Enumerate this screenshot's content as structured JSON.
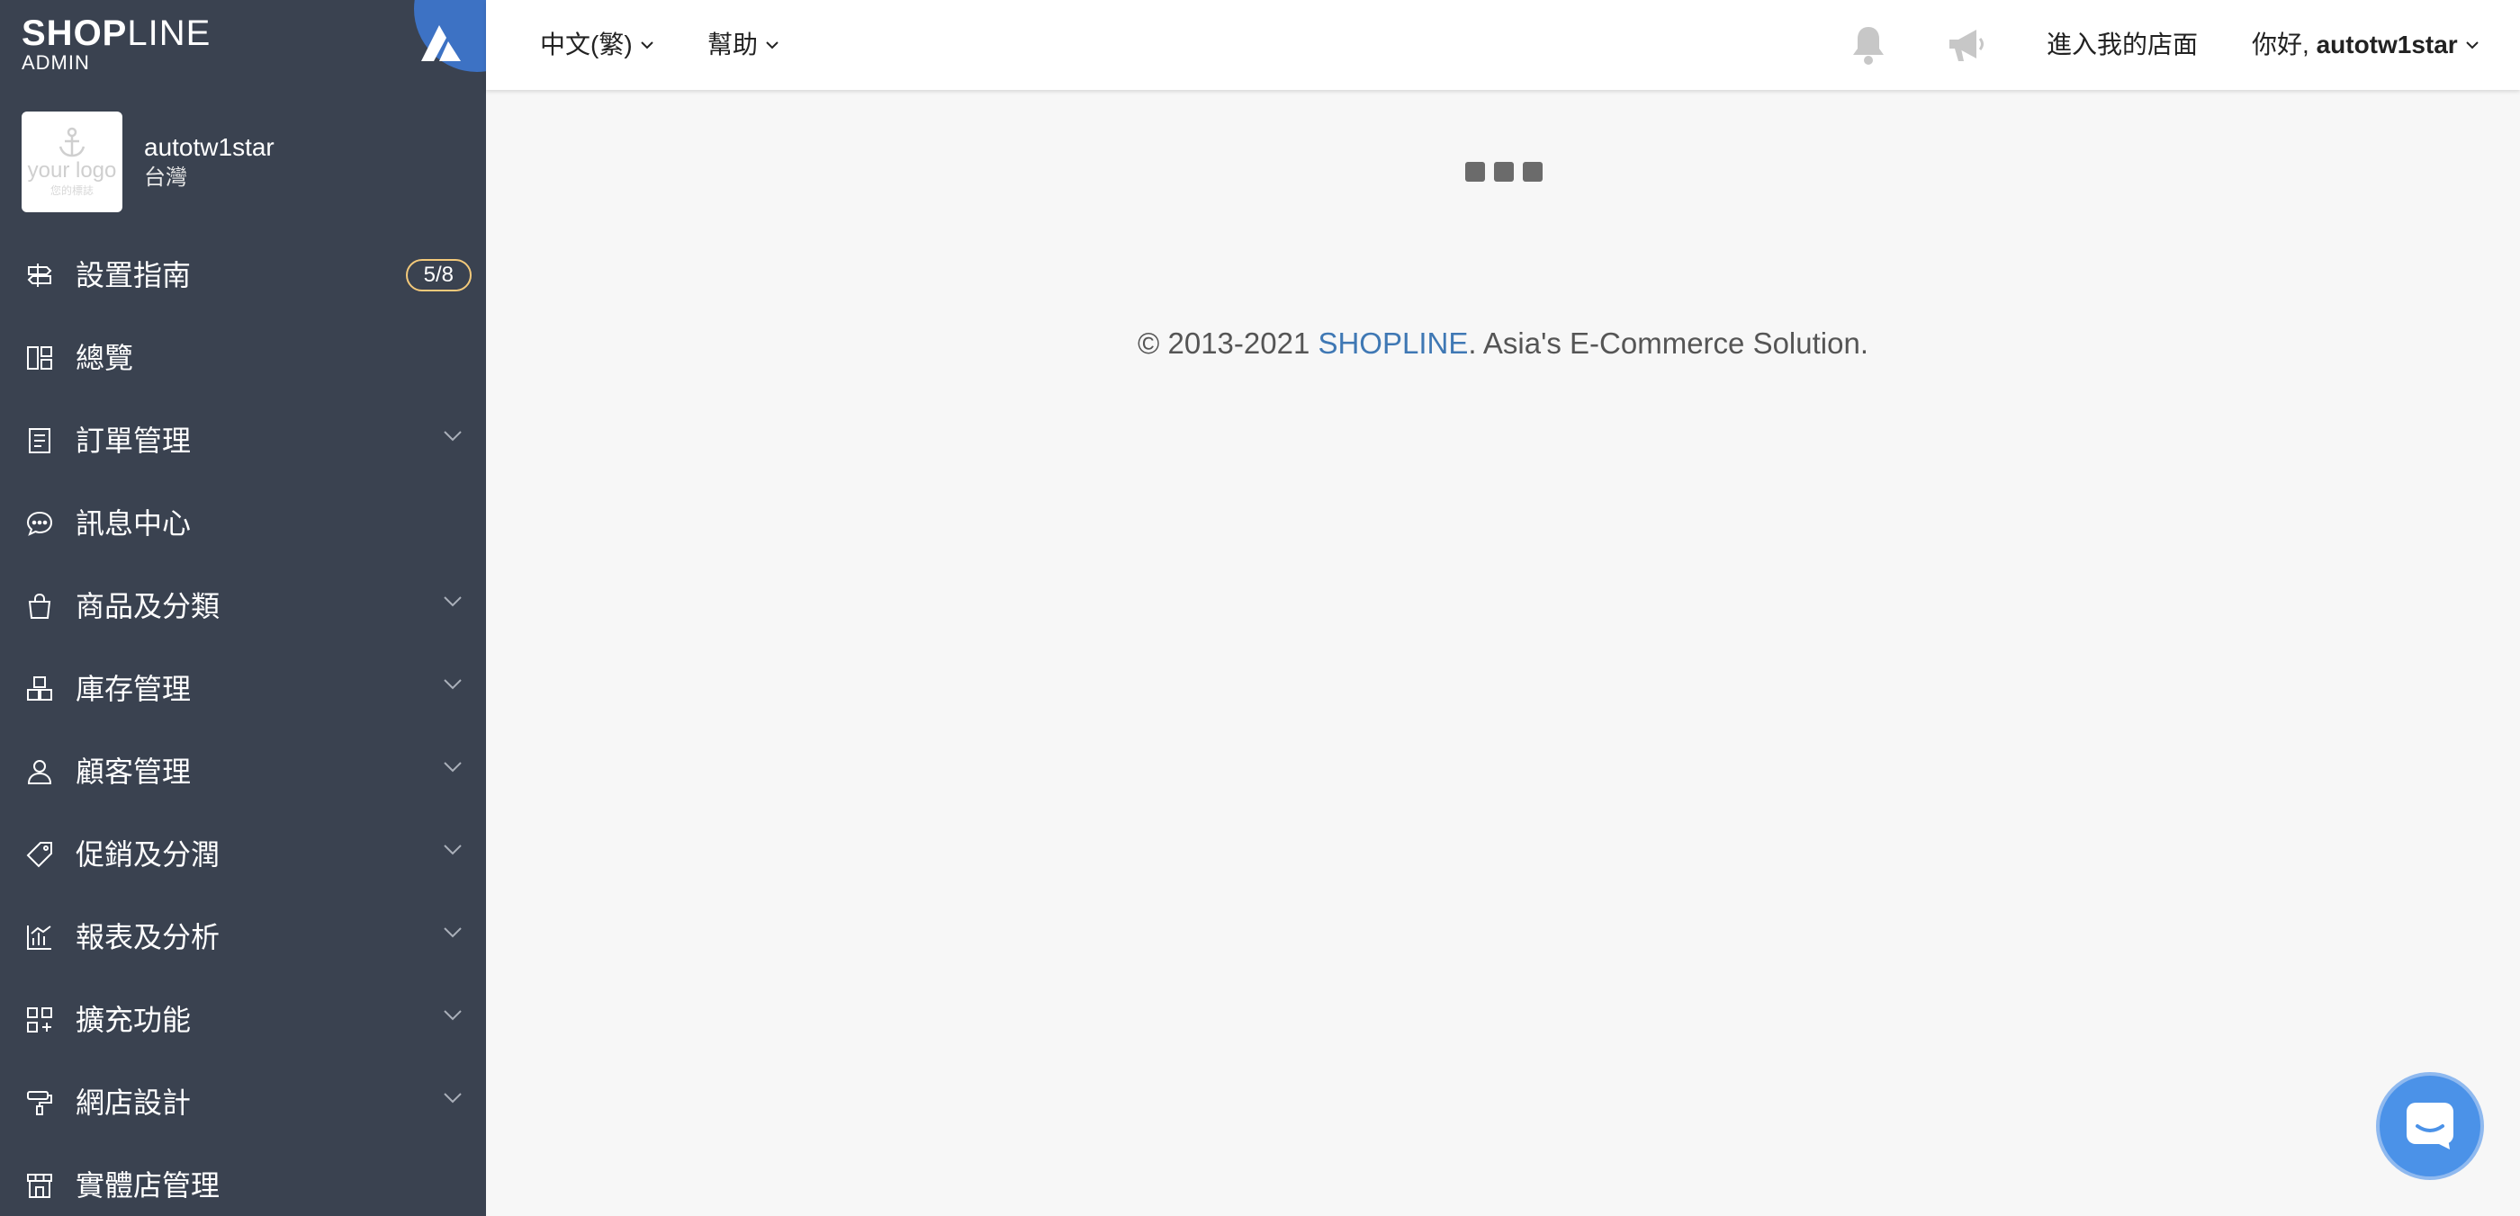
{
  "brand": {
    "name": "SHOPLINE",
    "sub": "ADMIN"
  },
  "store": {
    "name": "autotw1star",
    "region": "台灣",
    "logo_text": "your logo",
    "logo_caption": "您的標誌"
  },
  "sidebar": {
    "items": [
      {
        "label": "設置指南",
        "icon": "signpost-icon",
        "badge": "5/8",
        "has_chevron": false
      },
      {
        "label": "總覽",
        "icon": "dashboard-icon",
        "has_chevron": false
      },
      {
        "label": "訂單管理",
        "icon": "order-icon",
        "has_chevron": true
      },
      {
        "label": "訊息中心",
        "icon": "chat-bubble-icon",
        "has_chevron": false
      },
      {
        "label": "商品及分類",
        "icon": "shopping-bag-icon",
        "has_chevron": true
      },
      {
        "label": "庫存管理",
        "icon": "inventory-icon",
        "has_chevron": true
      },
      {
        "label": "顧客管理",
        "icon": "user-icon",
        "has_chevron": true
      },
      {
        "label": "促銷及分潤",
        "icon": "tag-icon",
        "has_chevron": true
      },
      {
        "label": "報表及分析",
        "icon": "chart-icon",
        "has_chevron": true
      },
      {
        "label": "擴充功能",
        "icon": "apps-icon",
        "has_chevron": true
      },
      {
        "label": "網店設計",
        "icon": "paint-roller-icon",
        "has_chevron": true
      },
      {
        "label": "實體店管理",
        "icon": "store-icon",
        "has_chevron": false
      }
    ]
  },
  "topbar": {
    "language": "中文(繁)",
    "help": "幫助",
    "enter_store": "進入我的店面",
    "greeting_prefix": "你好, ",
    "username": "autotw1star",
    "icons": [
      "bell-icon",
      "megaphone-icon"
    ]
  },
  "footer": {
    "prefix": "© 2013-2021 ",
    "brand": "SHOPLINE",
    "suffix": ". Asia's E-Commerce Solution."
  },
  "colors": {
    "sidebar_bg": "#3a4250",
    "accent": "#3d72c4",
    "link": "#3f78b4",
    "badge_border": "#f3c97a",
    "chat_button": "#4b92e8"
  }
}
